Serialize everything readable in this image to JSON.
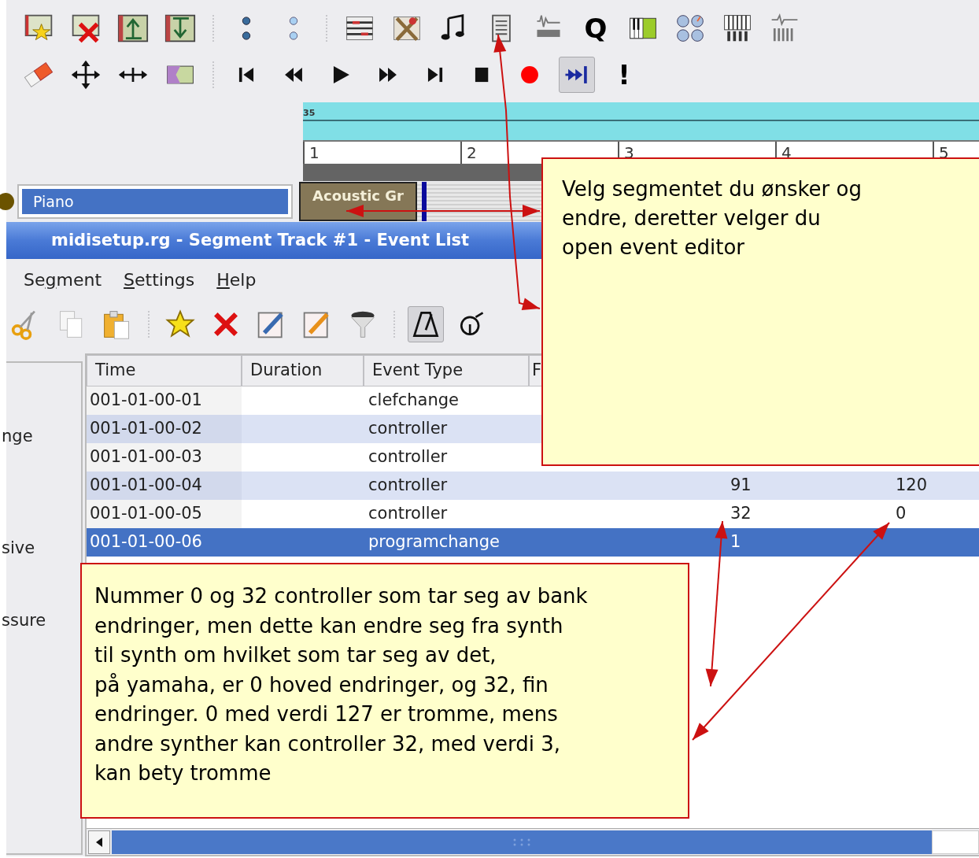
{
  "main_toolbar": {
    "rows": [
      [
        {
          "kind": "star-doc"
        },
        {
          "kind": "x-doc"
        },
        {
          "kind": "up-tracks"
        },
        {
          "kind": "down-tracks"
        },
        {
          "kind": "separator"
        },
        {
          "kind": "dots-dark"
        },
        {
          "kind": "dots-light"
        },
        {
          "kind": "separator"
        },
        {
          "kind": "matrix"
        },
        {
          "kind": "tools"
        },
        {
          "kind": "note"
        },
        {
          "kind": "document"
        },
        {
          "kind": "waveform"
        },
        {
          "kind": "text",
          "text": "Q"
        },
        {
          "kind": "keyboard"
        },
        {
          "kind": "knobs"
        },
        {
          "kind": "mixer"
        },
        {
          "kind": "synth"
        }
      ],
      [
        {
          "kind": "eraser"
        },
        {
          "kind": "move"
        },
        {
          "kind": "resize"
        },
        {
          "kind": "split"
        },
        {
          "kind": "separator"
        },
        {
          "kind": "skip-start"
        },
        {
          "kind": "rewind"
        },
        {
          "kind": "play"
        },
        {
          "kind": "forward"
        },
        {
          "kind": "skip-end"
        },
        {
          "kind": "stop"
        },
        {
          "kind": "record"
        },
        {
          "kind": "loop",
          "pressed": true
        },
        {
          "kind": "text",
          "text": "!"
        }
      ]
    ]
  },
  "ruler": {
    "tempo": "35",
    "bars": [
      "1",
      "2",
      "3",
      "4",
      "5"
    ]
  },
  "track": {
    "name": "Piano",
    "segment": "Acoustic Gr"
  },
  "event_window": {
    "title": "midisetup.rg - Segment Track #1 - Event List",
    "menu": [
      "Se**g**ment",
      "**S**ettings",
      "**H**elp"
    ],
    "toolbar": [
      {
        "kind": "scissors"
      },
      {
        "kind": "copy"
      },
      {
        "kind": "paste"
      },
      {
        "kind": "separator"
      },
      {
        "kind": "star"
      },
      {
        "kind": "x"
      },
      {
        "kind": "edit-blue"
      },
      {
        "kind": "edit-orange"
      },
      {
        "kind": "funnel"
      },
      {
        "kind": "separator"
      },
      {
        "kind": "metronome",
        "pressed": true
      },
      {
        "kind": "spiral"
      }
    ],
    "side_panel": [
      "nge",
      "sive",
      "ssure"
    ],
    "table": {
      "columns": [
        "Time",
        "Duration",
        "Event Type",
        "F"
      ],
      "rows": [
        {
          "time": "001-01-00-01",
          "event_type": "clefchange",
          "selected": false
        },
        {
          "time": "001-01-00-02",
          "event_type": "controller",
          "selected": false
        },
        {
          "time": "001-01-00-03",
          "event_type": "controller",
          "selected": false
        },
        {
          "time": "001-01-00-04",
          "event_type": "controller",
          "column_5": "91",
          "column_6": "120",
          "selected": false
        },
        {
          "time": "001-01-00-05",
          "event_type": "controller",
          "column_5": "32",
          "column_6": "0",
          "selected": false
        },
        {
          "time": "001-01-00-06",
          "event_type": "programchange",
          "column_5": "1",
          "selected": true
        }
      ]
    }
  },
  "callouts": [
    {
      "text": "Velg segmentet du ønsker og\nendre, deretter velger du\nopen event editor"
    },
    {
      "text": "Nummer 0 og 32 controller som tar seg av bank\nendringer, men dette kan endre seg fra synth\ntil synth om hvilket som tar seg av det,\npå yamaha, er 0 hoved endringer, og 32, fin\nendringer. 0 med verdi 127 er tromme, mens\nandre synther kan controller 32, med verdi 3,\nkan bety tromme"
    }
  ]
}
